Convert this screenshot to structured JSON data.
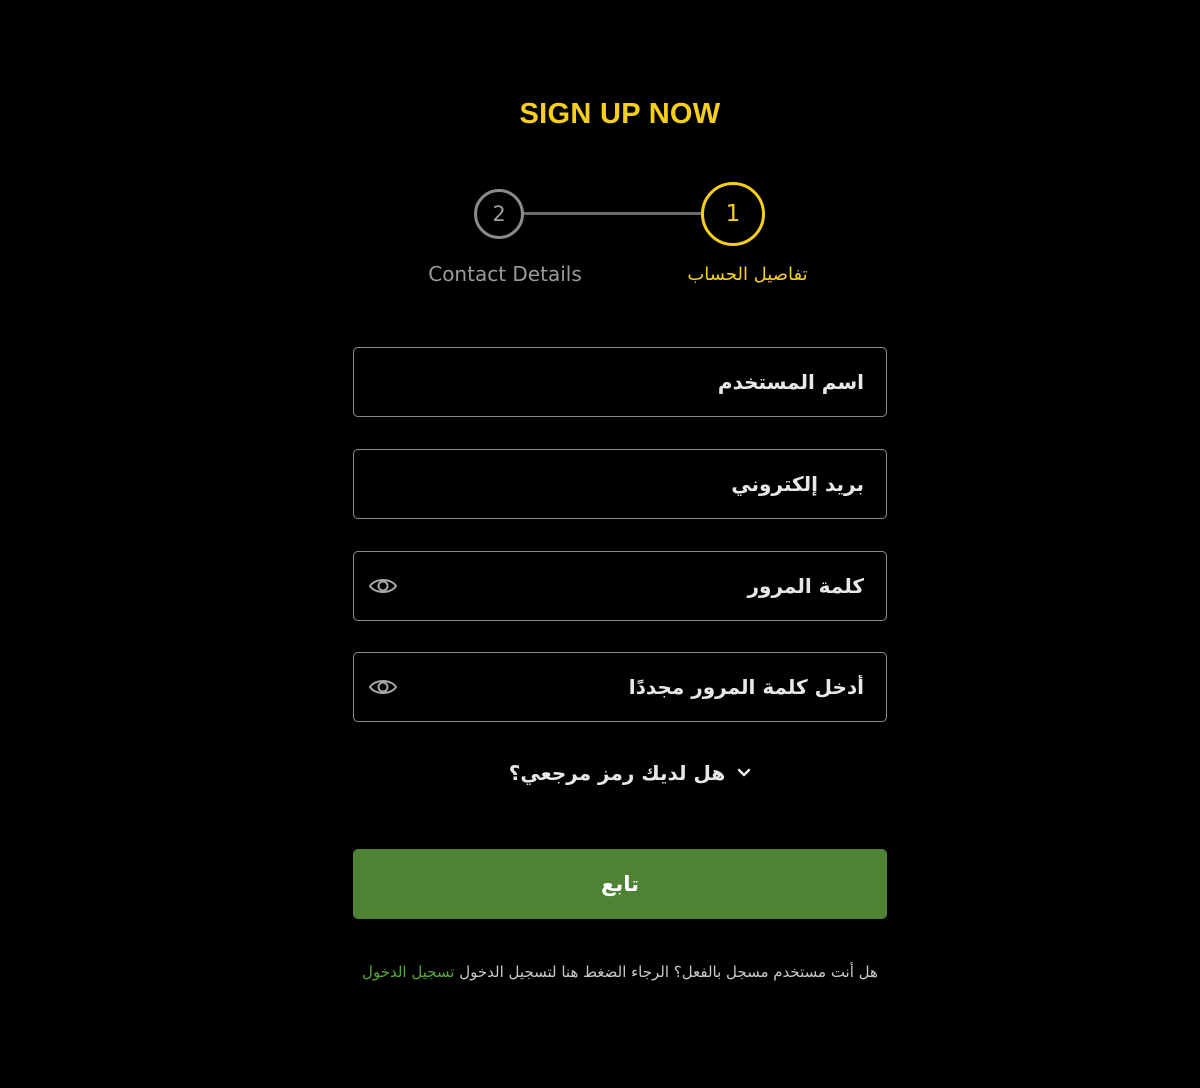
{
  "header": {
    "title": "SIGN UP NOW"
  },
  "stepper": {
    "steps": [
      {
        "number": "1",
        "label": "تفاصيل الحساب",
        "active": true
      },
      {
        "number": "2",
        "label": "Contact Details",
        "active": false
      }
    ]
  },
  "form": {
    "username": {
      "placeholder": "اسم المستخدم",
      "value": ""
    },
    "email": {
      "placeholder": "بريد إلكتروني",
      "value": ""
    },
    "password": {
      "placeholder": "كلمة المرور",
      "value": ""
    },
    "confirm_password": {
      "placeholder": "أدخل كلمة المرور مجددًا",
      "value": ""
    }
  },
  "referral": {
    "label": "هل لديك رمز مرجعي؟"
  },
  "continue_button": {
    "label": "تابع"
  },
  "login": {
    "prompt": "هل أنت مستخدم مسجل بالفعل؟ الرجاء الضغط هنا لتسجيل الدخول ",
    "link": "تسجيل الدخول"
  },
  "colors": {
    "accent": "#f5cf1c",
    "button": "#4f8235",
    "link": "#59a83a",
    "background": "#000000"
  },
  "icons": {
    "password_toggle": "eye-icon",
    "referral_toggle": "chevron-down-icon"
  }
}
